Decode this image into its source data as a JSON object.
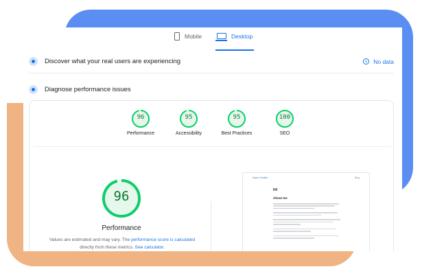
{
  "tabs": [
    {
      "label": "Mobile",
      "icon": "mobile-phone-icon",
      "active": false
    },
    {
      "label": "Desktop",
      "icon": "laptop-icon",
      "active": true
    }
  ],
  "field_section": {
    "title": "Discover what your real users are experiencing",
    "status": "No data",
    "icon": "users-chart-icon"
  },
  "diagnose_section": {
    "title": "Diagnose performance issues",
    "icon": "lighthouse-icon"
  },
  "categories": [
    {
      "label": "Performance",
      "score": "96",
      "fraction": 0.96
    },
    {
      "label": "Accessibility",
      "score": "95",
      "fraction": 0.95
    },
    {
      "label": "Best Practices",
      "score": "95",
      "fraction": 0.95
    },
    {
      "label": "SEO",
      "score": "100",
      "fraction": 1.0
    }
  ],
  "detail": {
    "score": "96",
    "fraction": 0.96,
    "label": "Performance",
    "note_prefix": "Values are estimated and may vary. The ",
    "note_link1": "performance score is calculated",
    "note_middle": " directly from these metrics. ",
    "note_link2": "See calculator."
  },
  "screenshot": {
    "site_name": "Arjun Hadke",
    "menu": "Blog",
    "greeting": "Hi!",
    "heading": "About me"
  },
  "colors": {
    "pass": "#0cce6b",
    "pass_text": "#0c7a2e",
    "gauge_fill": "#e6f8ec",
    "accent": "#1a73e8",
    "deco_blue": "#5b8ef2",
    "deco_orange": "#f0b484"
  }
}
